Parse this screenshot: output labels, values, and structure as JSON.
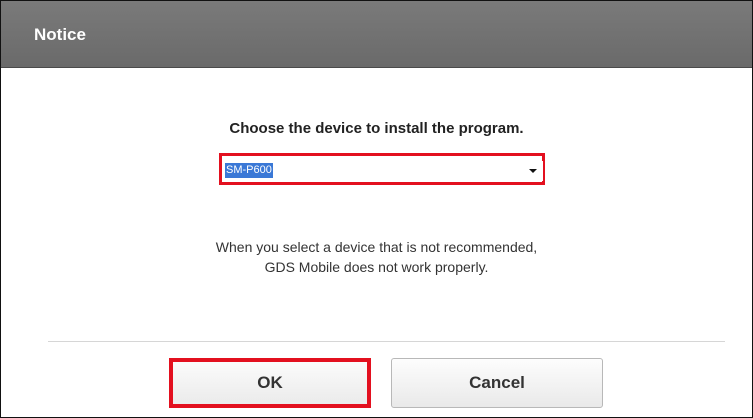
{
  "dialog": {
    "title": "Notice",
    "prompt": "Choose the device to install the program.",
    "device_select": {
      "selected_value": "SM-P600",
      "icon": "chevron-down-icon"
    },
    "warning_lines": [
      "When you select a device that is not recommended,",
      "GDS Mobile does not work properly."
    ],
    "buttons": {
      "ok_label": "OK",
      "cancel_label": "Cancel"
    }
  },
  "colors": {
    "titlebar": "#727272",
    "highlight": "#e3101f",
    "selection": "#3a78d6"
  }
}
